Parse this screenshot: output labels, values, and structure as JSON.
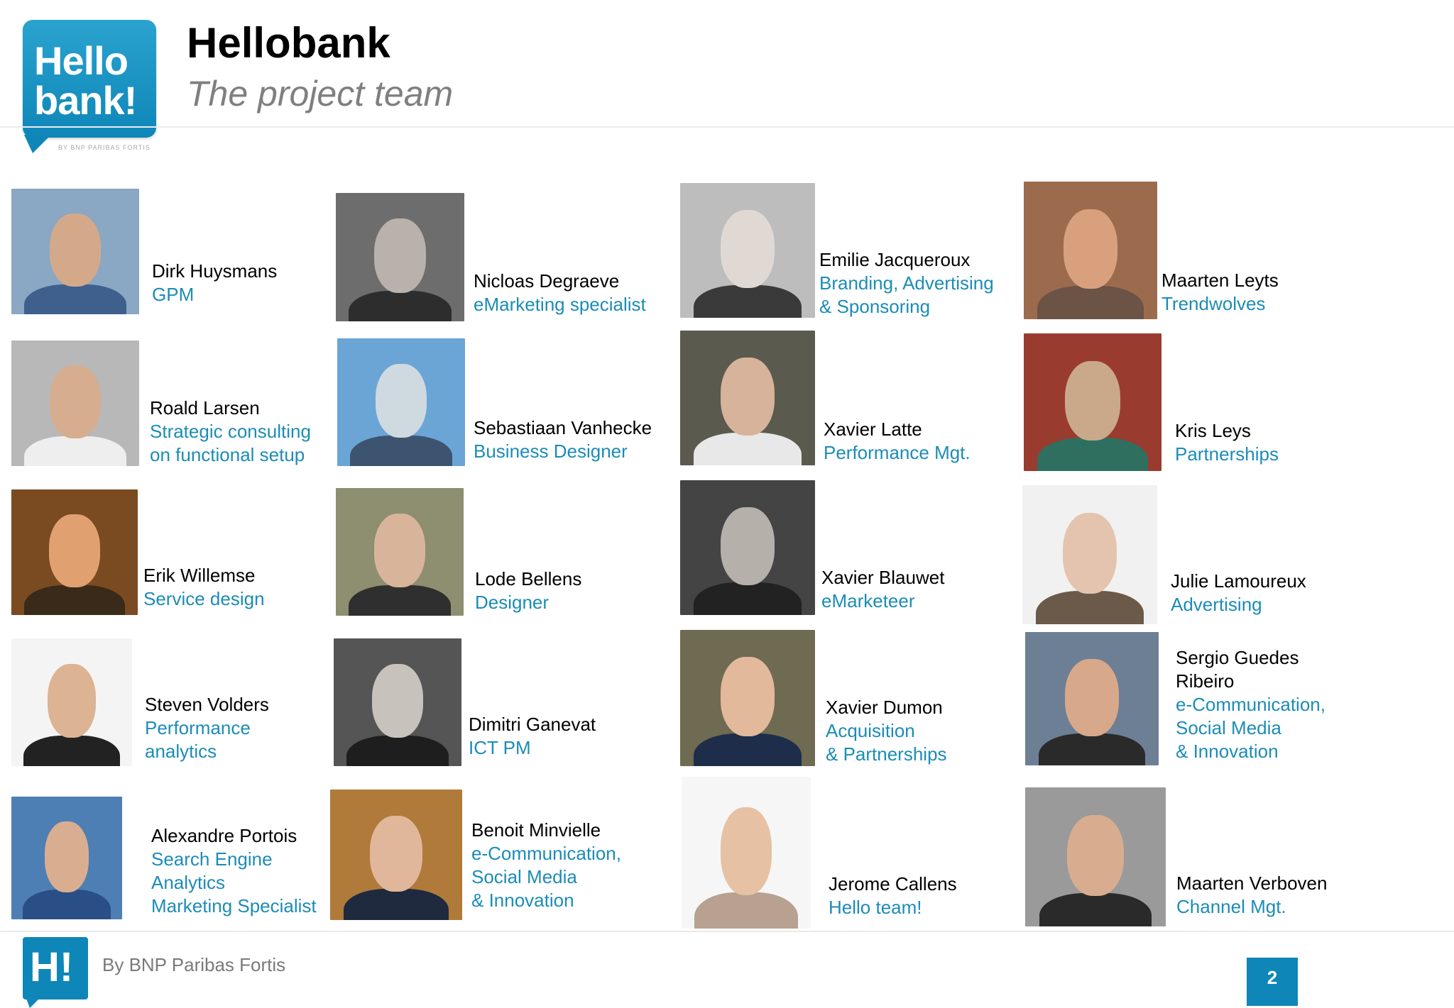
{
  "header": {
    "logo_text": "Hello bank!",
    "logo_tagline": "by BNP Paribas Fortis",
    "title": "Hellobank",
    "subtitle": "The project team"
  },
  "team": [
    {
      "name": "Dirk Huysmans",
      "role": "GPM"
    },
    {
      "name": "Nicloas Degraeve",
      "role": "eMarketing specialist"
    },
    {
      "name": "Emilie Jacqueroux",
      "role": "Branding, Advertising\n& Sponsoring"
    },
    {
      "name": "Maarten Leyts",
      "role": "Trendwolves"
    },
    {
      "name": "Roald Larsen",
      "role": "Strategic consulting\non functional setup"
    },
    {
      "name": "Sebastiaan Vanhecke",
      "role": "Business Designer"
    },
    {
      "name": "Xavier Latte",
      "role": "Performance Mgt."
    },
    {
      "name": "Kris Leys",
      "role": "Partnerships"
    },
    {
      "name": "Erik Willemse",
      "role": "Service design"
    },
    {
      "name": "Lode Bellens",
      "role": "Designer"
    },
    {
      "name": "Xavier Blauwet",
      "role": "eMarketeer"
    },
    {
      "name": "Julie Lamoureux",
      "role": "Advertising"
    },
    {
      "name": "Steven Volders",
      "role": "Performance\nanalytics"
    },
    {
      "name": "Dimitri Ganevat",
      "role": "ICT PM"
    },
    {
      "name": "Xavier Dumon",
      "role": "Acquisition\n& Partnerships"
    },
    {
      "name": "Sergio Guedes\nRibeiro",
      "role": "e-Communication,\nSocial Media\n& Innovation"
    },
    {
      "name": "Alexandre Portois",
      "role": "Search Engine\nAnalytics\nMarketing Specialist"
    },
    {
      "name": "Benoit Minvielle",
      "role": "e-Communication,\nSocial Media\n& Innovation"
    },
    {
      "name": "Jerome Callens",
      "role": "Hello team!"
    },
    {
      "name": "Maarten Verboven",
      "role": "Channel Mgt."
    }
  ],
  "footer": {
    "logo_text": "H!",
    "text": "By BNP Paribas Fortis",
    "page_number": "2"
  }
}
